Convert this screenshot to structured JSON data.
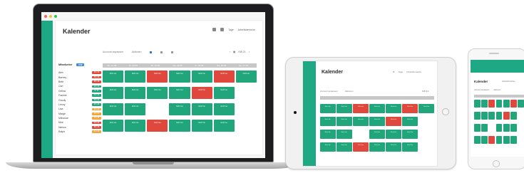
{
  "app": {
    "title": "Kalender",
    "topbar": {
      "view_label": "Tage",
      "department_label": "Arbeitsbereiche"
    },
    "filters": {
      "account_label": "Account anpassen",
      "sort_label": "Aktionen",
      "week_label": "KW 21"
    },
    "employee_header": {
      "label": "Mitarbeiter",
      "badge": "KW"
    },
    "days": [
      "Mo. 21.05",
      "Di. 22.05",
      "Mi. 23.05",
      "Do. 24.05",
      "Fr. 25.05",
      "Sa. 26.05",
      "So. 27.05"
    ],
    "employees": [
      {
        "name": "Alex",
        "badge": "30 / 40",
        "color": "#e0483d"
      },
      {
        "name": "Barney",
        "badge": "38 / 40",
        "color": "#e0483d"
      },
      {
        "name": "Beth",
        "badge": "38 / 40",
        "color": "#e0483d"
      },
      {
        "name": "Carl",
        "badge": "20 / 40",
        "color": "#21a57a"
      },
      {
        "name": "Celina",
        "badge": "8 / 40",
        "color": "#21a57a"
      },
      {
        "name": "Frankie",
        "badge": "40 / 40",
        "color": "#21a57a"
      },
      {
        "name": "Goody",
        "badge": "38 / 40",
        "color": "#21a57a"
      },
      {
        "name": "Lenny",
        "badge": "20 / 40",
        "color": "#21a57a"
      },
      {
        "name": "Lisa",
        "badge": "40 / 40",
        "color": "#f0a63a"
      },
      {
        "name": "Marge",
        "badge": "20 / 40",
        "color": "#f0a63a"
      },
      {
        "name": "Milhouse",
        "badge": "12 / 40",
        "color": "#f0a63a"
      },
      {
        "name": "Moe",
        "badge": "30 / 40",
        "color": "#e0483d"
      },
      {
        "name": "Nelson",
        "badge": "38 / 40",
        "color": "#e0483d"
      },
      {
        "name": "Ralph",
        "badge": "34 / 40",
        "color": "#f0a63a"
      }
    ],
    "shift_text": "Nicht Ver",
    "grid": [
      [
        "green",
        "green",
        "red",
        "green",
        "green",
        "red",
        "green"
      ],
      [
        "green",
        "green",
        "green",
        "green",
        "red",
        "green",
        "empty"
      ],
      [
        "green",
        "green",
        "empty",
        "green",
        "green",
        "green",
        "empty"
      ],
      [
        "green",
        "green",
        "red",
        "green",
        "green",
        "green",
        "empty"
      ]
    ],
    "colors": {
      "accent": "#1fa884",
      "shift": "#21a57a",
      "conflict": "#e0483d",
      "header_pill": "#3b8edb"
    }
  }
}
